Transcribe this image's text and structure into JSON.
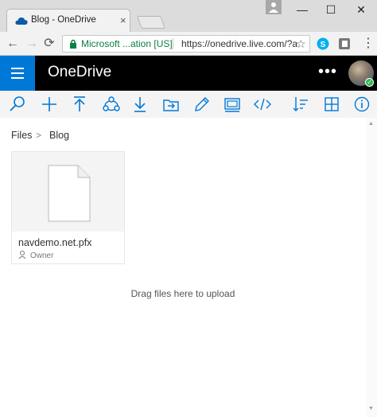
{
  "browser": {
    "tab_title": "Blog - OneDrive",
    "tab_close": "×",
    "window": {
      "minimize": "—",
      "maximize": "☐",
      "close": "✕"
    },
    "nav": {
      "back": "←",
      "forward": "→",
      "reload": "⟳"
    },
    "omnibox": {
      "ev_name": "Microsoft ...ation [US]",
      "url": "https://onedrive.live.com/?a"
    },
    "menu": "⋮",
    "bookmark_star": "☆"
  },
  "header": {
    "brand": "OneDrive",
    "more": "•••",
    "status_badge": "✓"
  },
  "commands": [
    {
      "icon": "search-icon"
    },
    {
      "icon": "add-icon"
    },
    {
      "icon": "upload-icon"
    },
    {
      "icon": "share-icon"
    },
    {
      "icon": "download-icon"
    },
    {
      "icon": "move-to-icon"
    },
    {
      "icon": "rename-icon"
    },
    {
      "icon": "embed-media-icon"
    },
    {
      "icon": "code-icon"
    },
    {
      "icon": "sort-icon"
    },
    {
      "icon": "tiles-view-icon"
    },
    {
      "icon": "info-icon"
    }
  ],
  "breadcrumb": {
    "root": "Files",
    "separator": ">",
    "current": "Blog"
  },
  "files": [
    {
      "name": "navdemo.net.pfx",
      "role": "Owner"
    }
  ],
  "drop_hint": "Drag files here to upload",
  "colors": {
    "accent": "#0078d7",
    "header_bg": "#000000",
    "ev_green": "#0b8043"
  }
}
